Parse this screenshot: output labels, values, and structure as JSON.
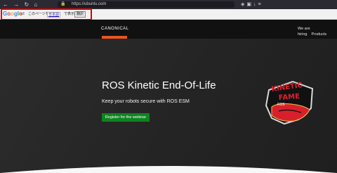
{
  "browser": {
    "url": "https://ubuntu.com",
    "nav_glyphs": {
      "back": "←",
      "forward": "→",
      "reload": "↻",
      "home": "⌂"
    },
    "icons": [
      "shield-icon",
      "lock-icon",
      "extensions-icon",
      "menu-icon"
    ]
  },
  "translate_bar": {
    "brand": {
      "g1": "G",
      "o1": "o",
      "o2": "o",
      "g2": "g",
      "l": "l",
      "e": "e"
    },
    "prompt": "このページを",
    "language": "日本語",
    "suffix": "で表示",
    "button": "翻訳"
  },
  "site": {
    "logo": "CANONICAL",
    "nav": {
      "hiring": "We are hiring",
      "products": "Products"
    },
    "accent": "#e95420"
  },
  "hero": {
    "title": "ROS Kinetic End-Of-Life",
    "subtitle": "Keep your robots secure with ROS ESM",
    "cta": "Register for the webinar",
    "cta_color": "#0e8420",
    "badge": {
      "line1": "KINETIC",
      "line2": "FAME",
      "tag": "ROS"
    }
  }
}
